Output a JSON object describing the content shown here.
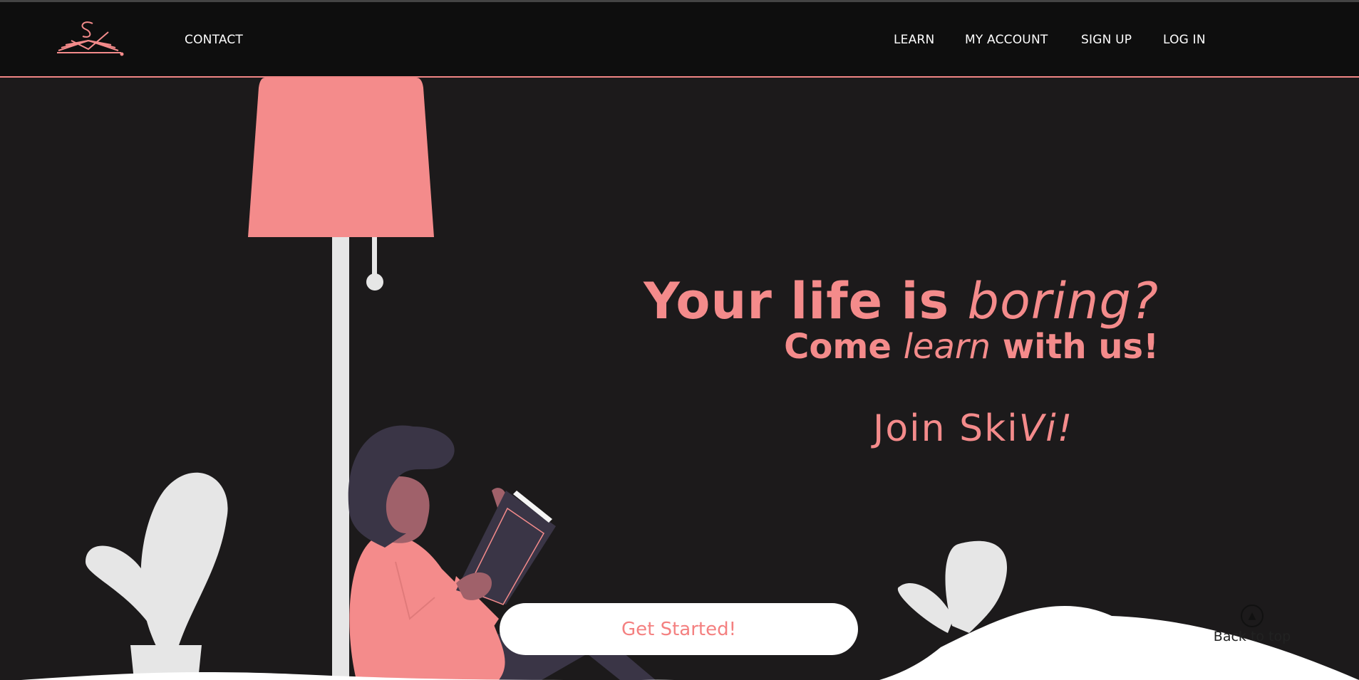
{
  "colors": {
    "accent": "#f48b8b",
    "background": "#1c1a1b",
    "navbar": "#0e0e0e",
    "plant": "#e6e6e6",
    "dark_figure": "#3a3546"
  },
  "nav": {
    "logo_icon": "open-book-s-logo",
    "contact": "CONTACT",
    "learn": "LEARN",
    "my_account": "MY ACCOUNT",
    "sign_up": "SIGN UP",
    "log_in": "LOG IN"
  },
  "hero": {
    "line1_bold": "Your life is ",
    "line1_italic": "boring?",
    "line2_a": "Come ",
    "line2_italic": "learn",
    "line2_b": " with us!",
    "join_plain": "Join Ski",
    "join_italic": "Vi!",
    "cta": "Get Started!",
    "illustration": "woman-reading-under-lamp"
  },
  "back_to_top": {
    "icon": "up-arrow-circle-icon",
    "label": "Back to top"
  }
}
